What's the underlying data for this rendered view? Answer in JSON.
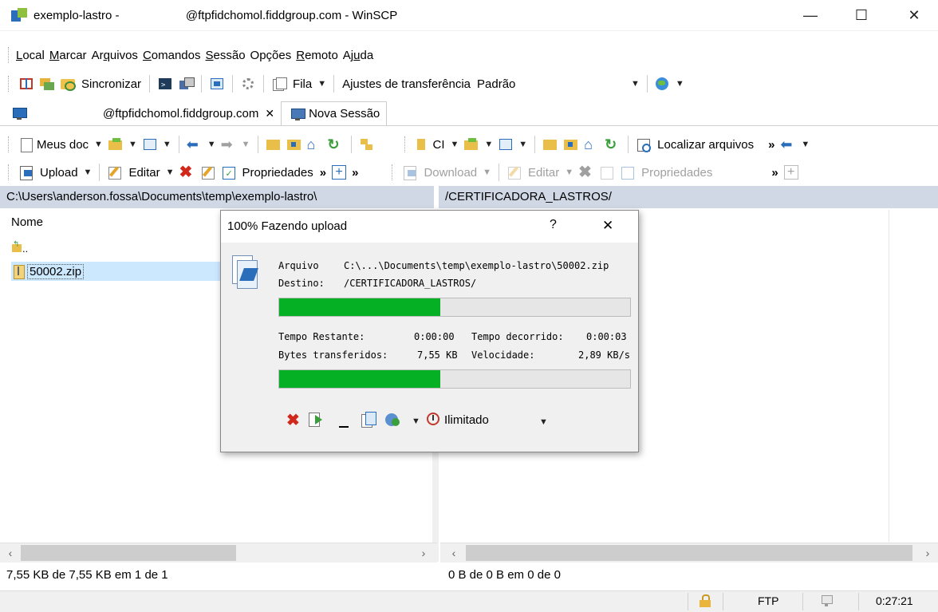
{
  "window": {
    "title": "exemplo-lastro -                    @ftpfidchomol.fiddgroup.com - WinSCP",
    "minimize": "—",
    "maximize": "☐",
    "close": "✕"
  },
  "menu": [
    "Local",
    "Marcar",
    "Arquivos",
    "Comandos",
    "Sessão",
    "Opções",
    "Remoto",
    "Ajuda"
  ],
  "toolbar1": {
    "sync_label": "Sincronizar",
    "queue_label": "Fila",
    "transfer_label": "Ajustes de transferência",
    "transfer_value": "Padrão"
  },
  "tabs": {
    "session_tab": "@ftpfidchomol.fiddgroup.com",
    "session_close": "✕",
    "new_session": "Nova Sessão"
  },
  "left_nav": {
    "location": "Meus doc"
  },
  "right_nav": {
    "location": "CI",
    "find_label": "Localizar arquivos"
  },
  "left_actions": {
    "upload": "Upload",
    "edit": "Editar",
    "properties": "Propriedades"
  },
  "right_actions": {
    "download": "Download",
    "edit": "Editar",
    "properties": "Propriedades"
  },
  "left_panel": {
    "path": "C:\\Users\\anderson.fossa\\Documents\\temp\\exemplo-lastro\\",
    "column_name": "Nome",
    "parent": "..",
    "files": [
      "50002.zip"
    ],
    "status": "7,55 KB de 7,55 KB em 1 de 1"
  },
  "right_panel": {
    "path": "/CERTIFICADORA_LASTROS/",
    "status": "0 B de 0 B em 0 de 0"
  },
  "bottom_status": {
    "protocol": "FTP",
    "time": "0:27:21"
  },
  "dialog": {
    "title": "100% Fazendo upload",
    "help": "?",
    "close": "✕",
    "file_label": "Arquivo",
    "file_value": "C:\\...\\Documents\\temp\\exemplo-lastro\\50002.zip",
    "dest_label": "Destino:",
    "dest_value": "/CERTIFICADORA_LASTROS/",
    "file_progress": 0.46,
    "time_left_label": "Tempo Restante:",
    "time_left_value": "0:00:00",
    "elapsed_label": "Tempo decorrido:",
    "elapsed_value": "0:00:03",
    "bytes_label": "Bytes transferidos:",
    "bytes_value": "7,55 KB",
    "speed_label": "Velocidade:",
    "speed_value": "2,89 KB/s",
    "total_progress": 0.46,
    "speed_limit": "Ilimitado"
  },
  "colors": {
    "progress": "#06b025",
    "path_bar": "#d0d8e6"
  }
}
